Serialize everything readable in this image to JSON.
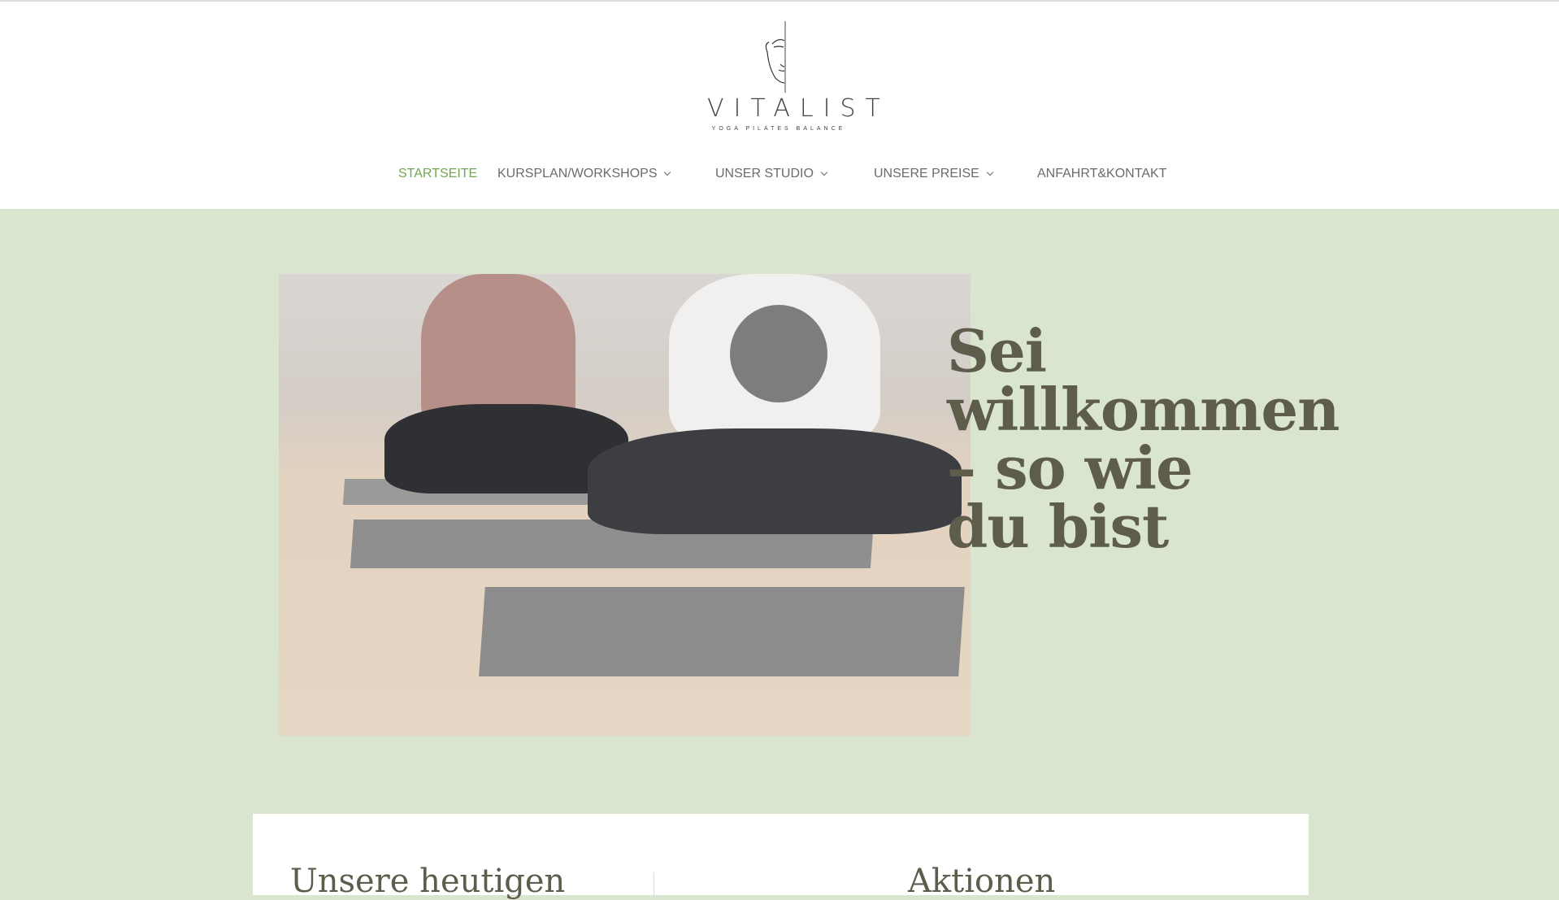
{
  "logo": {
    "name": "VITALIST",
    "tagline": "YOGA   PILATES   BALANCE"
  },
  "nav": {
    "items": [
      {
        "label": "STARTSEITE",
        "active": true
      },
      {
        "label": "KURSPLAN/WORKSHOPS",
        "dropdown": true
      },
      {
        "label": "UNSER STUDIO",
        "dropdown": true
      },
      {
        "label": "UNSERE PREISE",
        "dropdown": true
      },
      {
        "label": "ANFAHRT&KONTAKT"
      }
    ]
  },
  "hero": {
    "title_lines": [
      "Sei",
      "willkommen",
      "– so wie",
      "du bist"
    ]
  },
  "panel": {
    "left_heading": "Unsere heutigen",
    "right_heading": "Aktionen"
  },
  "colors": {
    "background": "#dae5d0",
    "accent": "#6fa653",
    "heading": "#5e5c4b"
  }
}
